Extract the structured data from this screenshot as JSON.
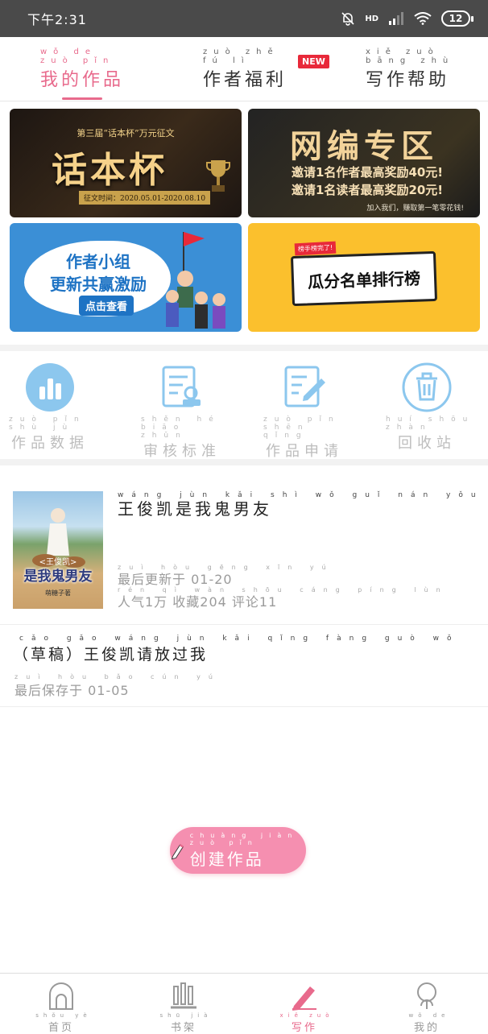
{
  "status_bar": {
    "time": "下午2:31",
    "hd": "HD",
    "battery": "12"
  },
  "tabs": [
    {
      "label": "我的作品",
      "pinyin": "wǒ de zuò pǐn",
      "active": true
    },
    {
      "label": "作者福利",
      "pinyin": "zuò zhě fú lì",
      "badge": "NEW"
    },
    {
      "label": "写作帮助",
      "pinyin": "xiě zuò bāng zhù"
    }
  ],
  "banners": {
    "b1": {
      "subtitle": "第三届“话本杯”万元征文",
      "title": "话本杯",
      "date": "征文时间：2020.05.01-2020.08.10"
    },
    "b2": {
      "title": "网编专区",
      "line1": "邀请1名作者最高奖励40元!",
      "line2": "邀请1名读者最高奖励20元!",
      "foot": "加入我们，赚取第一笔零花钱!"
    },
    "b3": {
      "line1": "作者小组",
      "line2": "更新共赢激励",
      "button": "点击查看"
    },
    "b4": {
      "tag": "榜手榜完了!",
      "title": "瓜分名单排行榜"
    }
  },
  "tools": [
    {
      "label": "作品数据",
      "pinyin": "zuò pǐn shù jù",
      "icon": "bar-chart-icon"
    },
    {
      "label": "审核标准",
      "pinyin": "shěn hé biāo zhǔn",
      "icon": "review-icon"
    },
    {
      "label": "作品申请",
      "pinyin": "zuò pǐn shēn qǐng",
      "icon": "edit-doc-icon"
    },
    {
      "label": "回收站",
      "pinyin": "huí shōu zhàn",
      "icon": "trash-icon"
    }
  ],
  "work": {
    "title": "王俊凯是我鬼男友",
    "title_pinyin": "wáng jùn kǎi shì wǒ guǐ nán yǒu",
    "cover_small": "<王俊凯>",
    "cover_title": "是我鬼男友",
    "cover_author": "萌糖子著",
    "updated": "最后更新于 01-20",
    "updated_pinyin": "zuì hòu gēng xīn yú",
    "stats": "人气1万 收藏204 评论11",
    "stats_pinyin": "rén qì wàn shōu cáng píng lùn"
  },
  "draft": {
    "title": "（草稿）王俊凯请放过我",
    "title_pinyin": "cǎo gǎo wáng jùn kǎi qǐng fàng guò wǒ",
    "saved": "最后保存于 01-05",
    "saved_pinyin": "zuì hòu bǎo cún yú"
  },
  "create_button": {
    "label": "创建作品",
    "pinyin": "chuàng jiàn zuò pǐn"
  },
  "bottom_nav": [
    {
      "label": "首页",
      "pinyin": "shǒu yè",
      "icon": "home-icon"
    },
    {
      "label": "书架",
      "pinyin": "shū jià",
      "icon": "bookshelf-icon"
    },
    {
      "label": "写作",
      "pinyin": "xiě zuò",
      "icon": "pen-icon",
      "active": true
    },
    {
      "label": "我的",
      "pinyin": "wǒ de",
      "icon": "profile-icon"
    }
  ],
  "colors": {
    "accent": "#e86a8c",
    "button": "#f58fb0",
    "tool_icon": "#8cc7ee"
  }
}
